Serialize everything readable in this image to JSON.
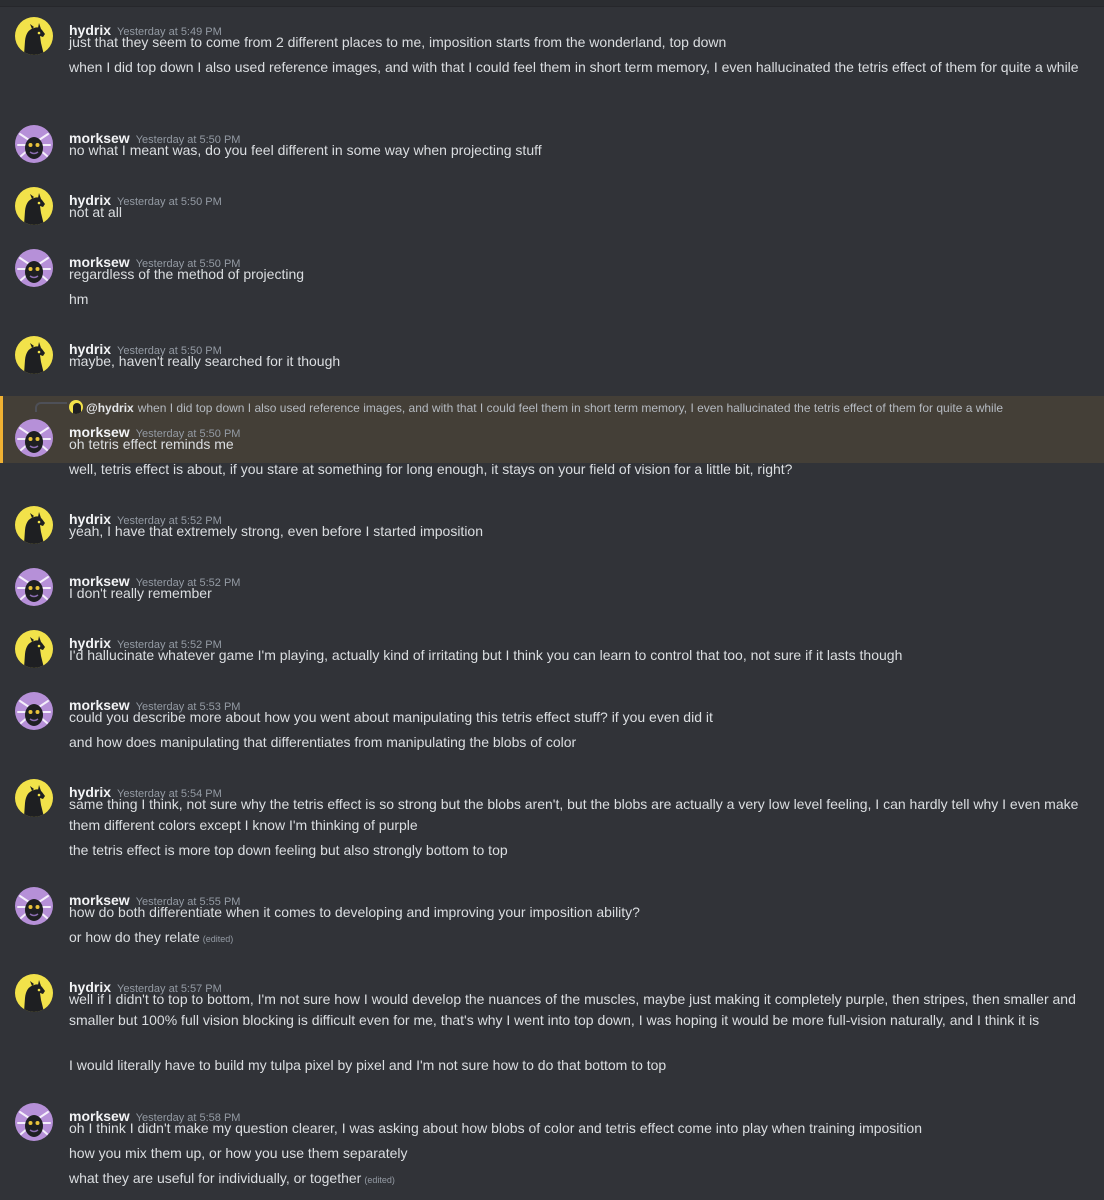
{
  "colors": {
    "background": "#313338",
    "username": "#f2f3f5",
    "timestamp": "#949ba4",
    "text": "#dbdee1",
    "mention_highlight": "#f0b132",
    "hydrix_avatar_bg": "#f2e24a",
    "morksew_avatar_bg": "#b690d8"
  },
  "messages": [
    {
      "author": "hydrix",
      "avatar": "hydrix-avatar-icon",
      "timestamp": "Yesterday at 5:49 PM",
      "lines": [
        {
          "text": "just that they seem to come from 2 different places to me, imposition starts from the wonderland, top down"
        },
        {
          "text": "when I did top down I also used reference images, and with that I could feel them in short term memory, I even hallucinated the tetris effect of them for quite a while"
        }
      ]
    },
    {
      "author": "morksew",
      "avatar": "morksew-avatar-icon",
      "timestamp": "Yesterday at 5:50 PM",
      "lines": [
        {
          "text": "no what I meant was, do you feel different in some way when projecting stuff"
        }
      ]
    },
    {
      "author": "hydrix",
      "avatar": "hydrix-avatar-icon",
      "timestamp": "Yesterday at 5:50 PM",
      "lines": [
        {
          "text": "not at all"
        }
      ]
    },
    {
      "author": "morksew",
      "avatar": "morksew-avatar-icon",
      "timestamp": "Yesterday at 5:50 PM",
      "lines": [
        {
          "text": "regardless of the method of projecting"
        },
        {
          "text": "hm"
        }
      ]
    },
    {
      "author": "hydrix",
      "avatar": "hydrix-avatar-icon",
      "timestamp": "Yesterday at 5:50 PM",
      "lines": [
        {
          "text": "maybe, haven't really searched for it though"
        }
      ]
    },
    {
      "author": "morksew",
      "avatar": "morksew-avatar-icon",
      "timestamp": "Yesterday at 5:50 PM",
      "reply": {
        "mention": "@hydrix",
        "text": "when I did top down I also used reference images, and with that I could feel them in short term memory, I even hallucinated the tetris effect of them for quite a while"
      },
      "lines": [
        {
          "text": "oh tetris effect reminds me"
        },
        {
          "text": "well, tetris effect is about, if you stare at something for long enough, it stays on your field of vision for a little bit, right?"
        }
      ]
    },
    {
      "author": "hydrix",
      "avatar": "hydrix-avatar-icon",
      "timestamp": "Yesterday at 5:52 PM",
      "lines": [
        {
          "text": "yeah, I have that extremely strong, even before I started imposition"
        }
      ]
    },
    {
      "author": "morksew",
      "avatar": "morksew-avatar-icon",
      "timestamp": "Yesterday at 5:52 PM",
      "lines": [
        {
          "text": "I don't really remember"
        }
      ]
    },
    {
      "author": "hydrix",
      "avatar": "hydrix-avatar-icon",
      "timestamp": "Yesterday at 5:52 PM",
      "lines": [
        {
          "text": "I'd hallucinate whatever game I'm playing, actually kind of irritating but I think you can learn to control that too, not sure if it lasts though"
        }
      ]
    },
    {
      "author": "morksew",
      "avatar": "morksew-avatar-icon",
      "timestamp": "Yesterday at 5:53 PM",
      "lines": [
        {
          "text": "could you describe more about how you went about manipulating this tetris effect stuff? if you even did it"
        },
        {
          "text": "and how does manipulating that differentiates from manipulating the blobs of color"
        }
      ]
    },
    {
      "author": "hydrix",
      "avatar": "hydrix-avatar-icon",
      "timestamp": "Yesterday at 5:54 PM",
      "lines": [
        {
          "text": "same thing I think, not sure why the tetris effect is so strong but the blobs aren't, but the blobs are actually a very low level feeling, I can hardly tell why I even make them different colors except I know I'm thinking of purple"
        },
        {
          "text": "the tetris effect is more top down feeling but also strongly bottom to top"
        }
      ]
    },
    {
      "author": "morksew",
      "avatar": "morksew-avatar-icon",
      "timestamp": "Yesterday at 5:55 PM",
      "lines": [
        {
          "text": "how do both differentiate when it comes to developing and improving your imposition ability?"
        },
        {
          "text": "or how do they relate",
          "edited": "(edited)"
        }
      ]
    },
    {
      "author": "hydrix",
      "avatar": "hydrix-avatar-icon",
      "timestamp": "Yesterday at 5:57 PM",
      "lines": [
        {
          "text": "well if I didn't to top to bottom, I'm not sure how I would develop the nuances of the muscles, maybe just making it completely purple, then stripes, then smaller and smaller but 100% full vision blocking is difficult even for me, that's why I went into top down, I was hoping it would be more full-vision naturally, and I think it is"
        },
        {
          "text": "I would literally have to build my tulpa pixel by pixel and I'm not sure how to do that bottom to top"
        }
      ]
    },
    {
      "author": "morksew",
      "avatar": "morksew-avatar-icon",
      "timestamp": "Yesterday at 5:58 PM",
      "lines": [
        {
          "text": "oh I think I didn't make my question clearer, I was asking about how blobs of color and tetris effect come into play when training imposition"
        },
        {
          "text": "how you mix them up, or how you use them separately"
        },
        {
          "text": "what they are useful for individually, or together",
          "edited": "(edited)"
        }
      ]
    }
  ]
}
